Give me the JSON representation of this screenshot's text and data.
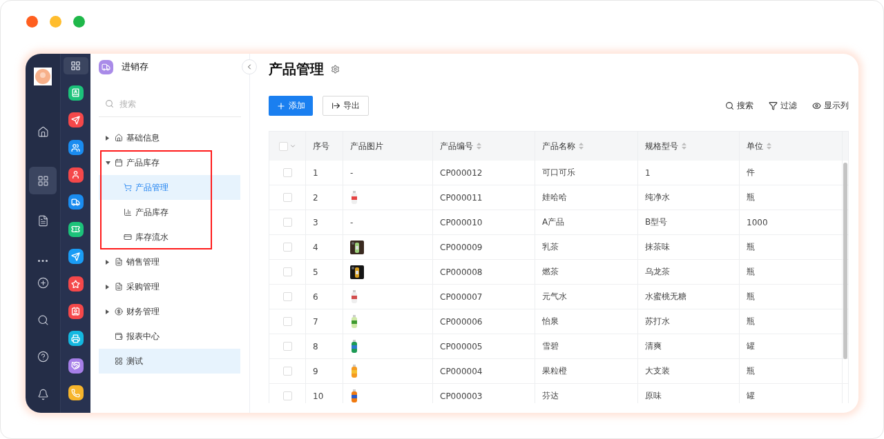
{
  "window": {
    "controls": [
      {
        "color": "#ff5f1f"
      },
      {
        "color": "#ffbd2e"
      },
      {
        "color": "#1fb84a"
      }
    ]
  },
  "rail": [
    {
      "selected": false
    },
    {
      "selected": true
    },
    {
      "selected": false
    },
    {
      "selected": false
    },
    {
      "selected": false
    },
    {
      "selected": false
    },
    {
      "selected": false
    },
    {
      "selected": false
    }
  ],
  "apps": [
    {
      "color": "#1cc27a"
    },
    {
      "color": "#f5484a"
    },
    {
      "color": "#1a8cf0"
    },
    {
      "color": "#f5484a"
    },
    {
      "color": "#1a8cf0"
    },
    {
      "color": "#1cc27a"
    },
    {
      "color": "#1a9cf5"
    },
    {
      "color": "#f5484a"
    },
    {
      "color": "#f5484a"
    },
    {
      "color": "#14b8e0"
    },
    {
      "color": "#a67ee8"
    },
    {
      "color": "#f7b52c"
    }
  ],
  "sidebar": {
    "title": "进销存",
    "search": {
      "placeholder": "搜索"
    },
    "items": [
      {
        "label": "基础信息",
        "expanded": false,
        "has_children": true,
        "highlighted": false,
        "selected": false,
        "hovered": false
      },
      {
        "label": "产品库存",
        "expanded": true,
        "has_children": true,
        "highlighted": true,
        "selected": false,
        "hovered": false,
        "children": [
          {
            "label": "产品管理",
            "selected": true
          },
          {
            "label": "产品库存",
            "selected": false
          },
          {
            "label": "库存流水",
            "selected": false
          }
        ]
      },
      {
        "label": "销售管理",
        "expanded": false,
        "has_children": true,
        "highlighted": false,
        "selected": false,
        "hovered": false
      },
      {
        "label": "采购管理",
        "expanded": false,
        "has_children": true,
        "highlighted": false,
        "selected": false,
        "hovered": false
      },
      {
        "label": "财务管理",
        "expanded": false,
        "has_children": true,
        "highlighted": false,
        "selected": false,
        "hovered": false
      },
      {
        "label": "报表中心",
        "expanded": false,
        "has_children": false,
        "highlighted": false,
        "selected": false,
        "hovered": false
      },
      {
        "label": "测试",
        "expanded": false,
        "has_children": false,
        "highlighted": false,
        "selected": false,
        "hovered": true
      }
    ]
  },
  "page": {
    "title": "产品管理",
    "toolbar": {
      "primary": "添加",
      "secondary": "导出",
      "actions": [
        "搜索",
        "过滤",
        "显示列"
      ]
    },
    "table": {
      "select_all": {
        "checked": false
      },
      "columns": [
        {
          "label": "序号",
          "sortable": false
        },
        {
          "label": "产品图片",
          "sortable": false
        },
        {
          "label": "产品编号",
          "sortable": true
        },
        {
          "label": "产品名称",
          "sortable": true
        },
        {
          "label": "规格型号",
          "sortable": true
        },
        {
          "label": "单位",
          "sortable": true
        }
      ],
      "rows": [
        {
          "checked": false,
          "index": "1",
          "image": {
            "kind": "dash",
            "text": "-"
          },
          "code": "CP000012",
          "name": "可口可乐",
          "spec": "1",
          "unit": "件"
        },
        {
          "checked": false,
          "index": "2",
          "code": "CP000011",
          "name": "娃哈哈",
          "spec": "纯净水",
          "unit": "瓶"
        },
        {
          "checked": false,
          "index": "3",
          "image": {
            "kind": "dash",
            "text": "-"
          },
          "code": "CP000010",
          "name": "A产品",
          "spec": "B型号",
          "unit": "1000"
        },
        {
          "checked": false,
          "index": "4",
          "code": "CP000009",
          "name": "乳茶",
          "spec": "抹茶味",
          "unit": "瓶"
        },
        {
          "checked": false,
          "index": "5",
          "code": "CP000008",
          "name": "燃茶",
          "spec": "乌龙茶",
          "unit": "瓶"
        },
        {
          "checked": false,
          "index": "6",
          "code": "CP000007",
          "name": "元气水",
          "spec": "水蜜桃无糖",
          "unit": "瓶"
        },
        {
          "checked": false,
          "index": "7",
          "code": "CP000006",
          "name": "怡泉",
          "spec": "苏打水",
          "unit": "瓶"
        },
        {
          "checked": false,
          "index": "8",
          "code": "CP000005",
          "name": "雪碧",
          "spec": "清爽",
          "unit": "罐"
        },
        {
          "checked": false,
          "index": "9",
          "code": "CP000004",
          "name": "果粒橙",
          "spec": "大支装",
          "unit": "瓶"
        },
        {
          "checked": false,
          "index": "10",
          "code": "CP000003",
          "name": "芬达",
          "spec": "原味",
          "unit": "罐"
        }
      ]
    }
  }
}
